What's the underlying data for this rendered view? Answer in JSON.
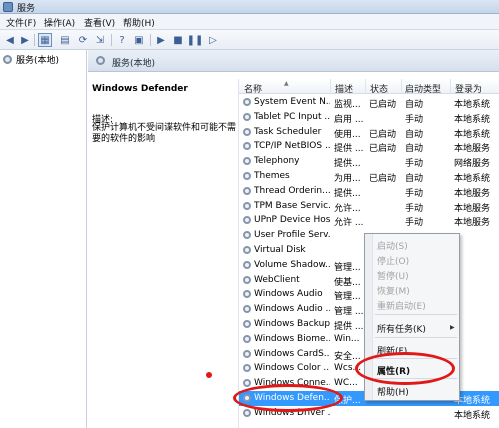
{
  "window": {
    "title": "服务"
  },
  "menu": {
    "file": "文件(F)",
    "action": "操作(A)",
    "view": "查看(V)",
    "help": "帮助(H)"
  },
  "toolbar": {
    "icons": [
      "back-arrow-icon",
      "forward-arrow-icon",
      "console-tree-icon",
      "properties-sheet-icon",
      "refresh-icon",
      "export-list-icon",
      "help-icon",
      "view-icon",
      "play-icon",
      "stop-icon",
      "pause-icon",
      "restart-icon"
    ]
  },
  "tree": {
    "root": "服务(本地)"
  },
  "main_header": {
    "title": "服务(本地)"
  },
  "description": {
    "service_name": "Windows Defender",
    "label": "描述:",
    "text": "保护计算机不受间谍软件和可能不需要的软件的影响"
  },
  "columns": [
    "名称",
    "描述",
    "状态",
    "启动类型",
    "登录为"
  ],
  "services": [
    {
      "name": "System Event N...",
      "desc": "监视...",
      "status": "已启动",
      "startup": "自动",
      "logon": "本地系统"
    },
    {
      "name": "Tablet PC Input ...",
      "desc": "启用 ...",
      "status": "",
      "startup": "手动",
      "logon": "本地系统"
    },
    {
      "name": "Task Scheduler",
      "desc": "使用...",
      "status": "已启动",
      "startup": "自动",
      "logon": "本地系统"
    },
    {
      "name": "TCP/IP NetBIOS ...",
      "desc": "提供 ...",
      "status": "已启动",
      "startup": "自动",
      "logon": "本地服务"
    },
    {
      "name": "Telephony",
      "desc": "提供...",
      "status": "",
      "startup": "手动",
      "logon": "网络服务"
    },
    {
      "name": "Themes",
      "desc": "为用...",
      "status": "已启动",
      "startup": "自动",
      "logon": "本地系统"
    },
    {
      "name": "Thread Orderin...",
      "desc": "提供...",
      "status": "",
      "startup": "手动",
      "logon": "本地服务"
    },
    {
      "name": "TPM Base Servic...",
      "desc": "允许...",
      "status": "",
      "startup": "手动",
      "logon": "本地服务"
    },
    {
      "name": "UPnP Device Host",
      "desc": "允许 ...",
      "status": "",
      "startup": "手动",
      "logon": "本地服务"
    },
    {
      "name": "User Profile Serv...",
      "desc": "",
      "status": "",
      "startup": "",
      "logon": ""
    },
    {
      "name": "Virtual Disk",
      "desc": "",
      "status": "",
      "startup": "",
      "logon": ""
    },
    {
      "name": "Volume Shadow...",
      "desc": "管理...",
      "status": "",
      "startup": "",
      "logon": ""
    },
    {
      "name": "WebClient",
      "desc": "使基...",
      "status": "",
      "startup": "",
      "logon": ""
    },
    {
      "name": "Windows Audio",
      "desc": "管理...",
      "status": "",
      "startup": "",
      "logon": ""
    },
    {
      "name": "Windows Audio ...",
      "desc": "管理 ...",
      "status": "",
      "startup": "",
      "logon": ""
    },
    {
      "name": "Windows Backup",
      "desc": "提供 ...",
      "status": "",
      "startup": "",
      "logon": ""
    },
    {
      "name": "Windows Biome...",
      "desc": "Win...",
      "status": "",
      "startup": "",
      "logon": ""
    },
    {
      "name": "Windows CardS...",
      "desc": "安全...",
      "status": "",
      "startup": "",
      "logon": ""
    },
    {
      "name": "Windows Color ...",
      "desc": "Wcs...",
      "status": "",
      "startup": "",
      "logon": ""
    },
    {
      "name": "Windows Conne...",
      "desc": "WC...",
      "status": "",
      "startup": "",
      "logon": ""
    },
    {
      "name": "Windows Defen...",
      "desc": "保护...",
      "status": "",
      "startup": "",
      "logon": "本地系统"
    },
    {
      "name": "Windows Driver ...",
      "desc": "",
      "status": "",
      "startup": "",
      "logon": "本地系统"
    }
  ],
  "context_menu": {
    "start": "启动(S)",
    "stop": "停止(O)",
    "pause": "暂停(U)",
    "resume": "恢复(M)",
    "restart": "重新启动(E)",
    "all_tasks": "所有任务(K)",
    "refresh": "刷新(F)",
    "properties": "属性(R)",
    "help": "帮助(H)"
  },
  "colors": {
    "selection": "#3399ff",
    "annotation": "#e01818"
  }
}
